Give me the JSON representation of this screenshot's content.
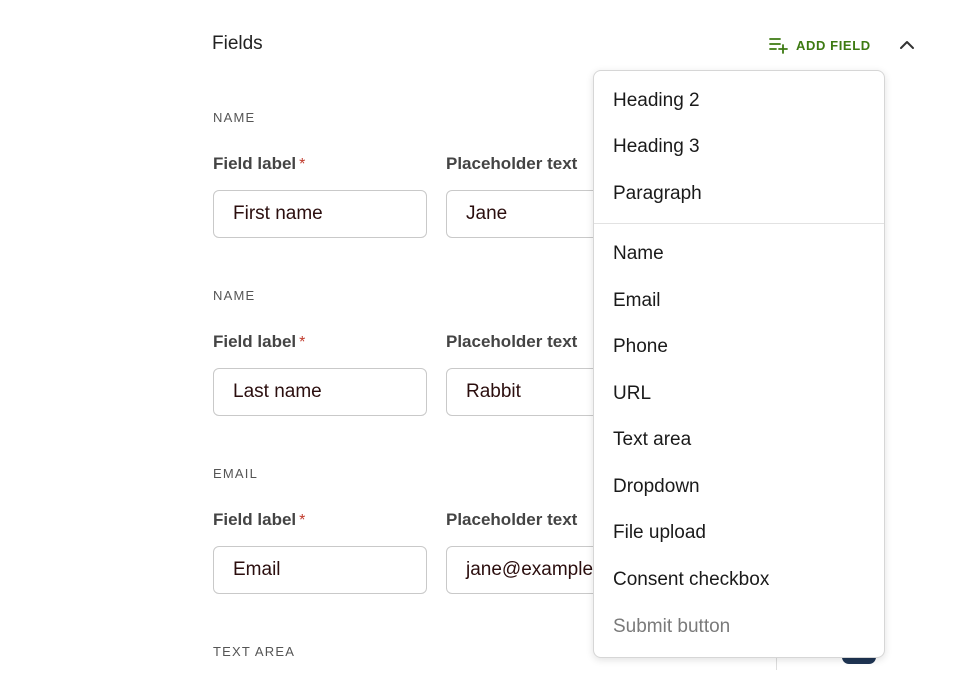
{
  "header": {
    "title": "Fields",
    "add_field_label": "ADD FIELD"
  },
  "sections": [
    {
      "type_label": "NAME",
      "field_label": "Field label",
      "required_mark": "*",
      "field_value": "First name",
      "placeholder_label": "Placeholder text",
      "placeholder_value": "Jane"
    },
    {
      "type_label": "NAME",
      "field_label": "Field label",
      "required_mark": "*",
      "field_value": "Last name",
      "placeholder_label": "Placeholder text",
      "placeholder_value": "Rabbit"
    },
    {
      "type_label": "EMAIL",
      "field_label": "Field label",
      "required_mark": "*",
      "field_value": "Email",
      "placeholder_label": "Placeholder text",
      "placeholder_value": "jane@example.com"
    },
    {
      "type_label": "TEXT AREA"
    }
  ],
  "menu": {
    "group1": [
      "Heading 2",
      "Heading 3",
      "Paragraph"
    ],
    "group2": [
      "Name",
      "Email",
      "Phone",
      "URL",
      "Text area",
      "Dropdown",
      "File upload",
      "Consent checkbox"
    ],
    "disabled_item": "Submit button"
  },
  "colors": {
    "accent": "#3d7a12",
    "required": "#c0392b",
    "toggle": "#1f3554"
  }
}
